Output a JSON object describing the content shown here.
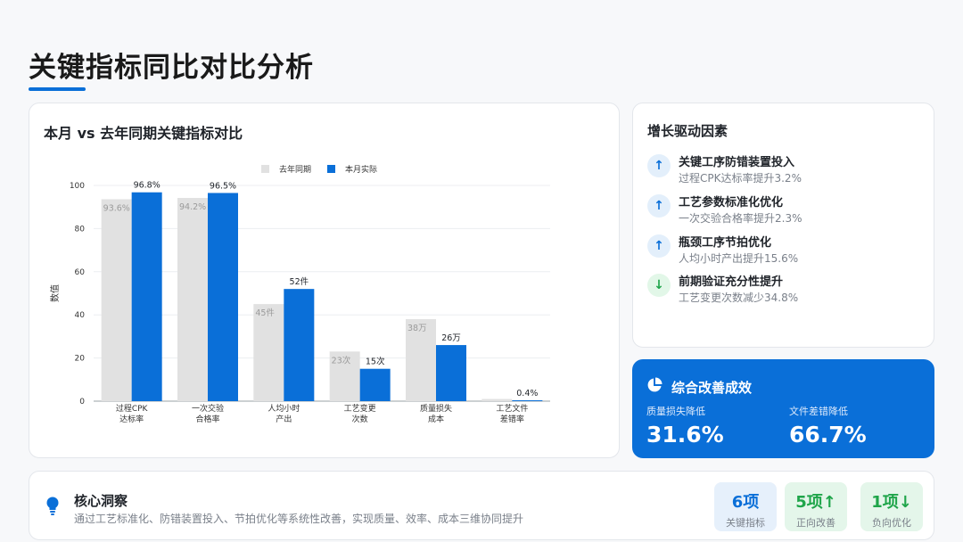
{
  "page": {
    "title": "关键指标同比对比分析"
  },
  "chart_card": {
    "title": "本月 vs 去年同期关键指标对比"
  },
  "chart_data": {
    "type": "bar",
    "ylabel": "数值",
    "ylim": [
      0,
      100
    ],
    "yticks": [
      0,
      20,
      40,
      60,
      80,
      100
    ],
    "categories": [
      [
        "过程CPK",
        "达标率"
      ],
      [
        "一次交验",
        "合格率"
      ],
      [
        "人均小时",
        "产出"
      ],
      [
        "工艺变更",
        "次数"
      ],
      [
        "质量损失",
        "成本"
      ],
      [
        "工艺文件",
        "差错率"
      ]
    ],
    "series": [
      {
        "name": "去年同期",
        "color": "#e1e1e1",
        "label_color": "#9a9a9a",
        "values": [
          93.6,
          94.2,
          45,
          23,
          38,
          1
        ],
        "labels": [
          "93.6%",
          "94.2%",
          "45件",
          "23次",
          "38万",
          ""
        ]
      },
      {
        "name": "本月实际",
        "color": "#0a6fd8",
        "label_color": "#1f2329",
        "values": [
          96.8,
          96.5,
          52,
          15,
          26,
          0.4
        ],
        "labels": [
          "96.8%",
          "96.5%",
          "52件",
          "15次",
          "26万",
          "0.4%"
        ]
      }
    ],
    "legend": "top-center",
    "grid": true
  },
  "drivers": {
    "title": "增长驱动因素",
    "items": [
      {
        "icon": "↑",
        "direction": "up",
        "title": "关键工序防错装置投入",
        "desc": "过程CPK达标率提升3.2%"
      },
      {
        "icon": "↑",
        "direction": "up",
        "title": "工艺参数标准化优化",
        "desc": "一次交验合格率提升2.3%"
      },
      {
        "icon": "↑",
        "direction": "up",
        "title": "瓶颈工序节拍优化",
        "desc": "人均小时产出提升15.6%"
      },
      {
        "icon": "↓",
        "direction": "down",
        "title": "前期验证充分性提升",
        "desc": "工艺变更次数减少34.8%"
      }
    ]
  },
  "summary": {
    "title": "综合改善成效",
    "metrics": [
      {
        "label": "质量损失降低",
        "value": "31.6%"
      },
      {
        "label": "文件差错降低",
        "value": "66.7%"
      }
    ]
  },
  "insight": {
    "title": "核心洞察",
    "text": "通过工艺标准化、防错装置投入、节拍优化等系统性改善，实现质量、效率、成本三维协同提升",
    "stats": [
      {
        "value": "6项",
        "label": "关键指标",
        "tone": "blue"
      },
      {
        "value": "5项↑",
        "label": "正向改善",
        "tone": "green"
      },
      {
        "value": "1项↓",
        "label": "负向优化",
        "tone": "green"
      }
    ]
  },
  "colors": {
    "accent": "#0a6fd8",
    "positive": "#1fa54a",
    "muted": "#e1e1e1"
  }
}
